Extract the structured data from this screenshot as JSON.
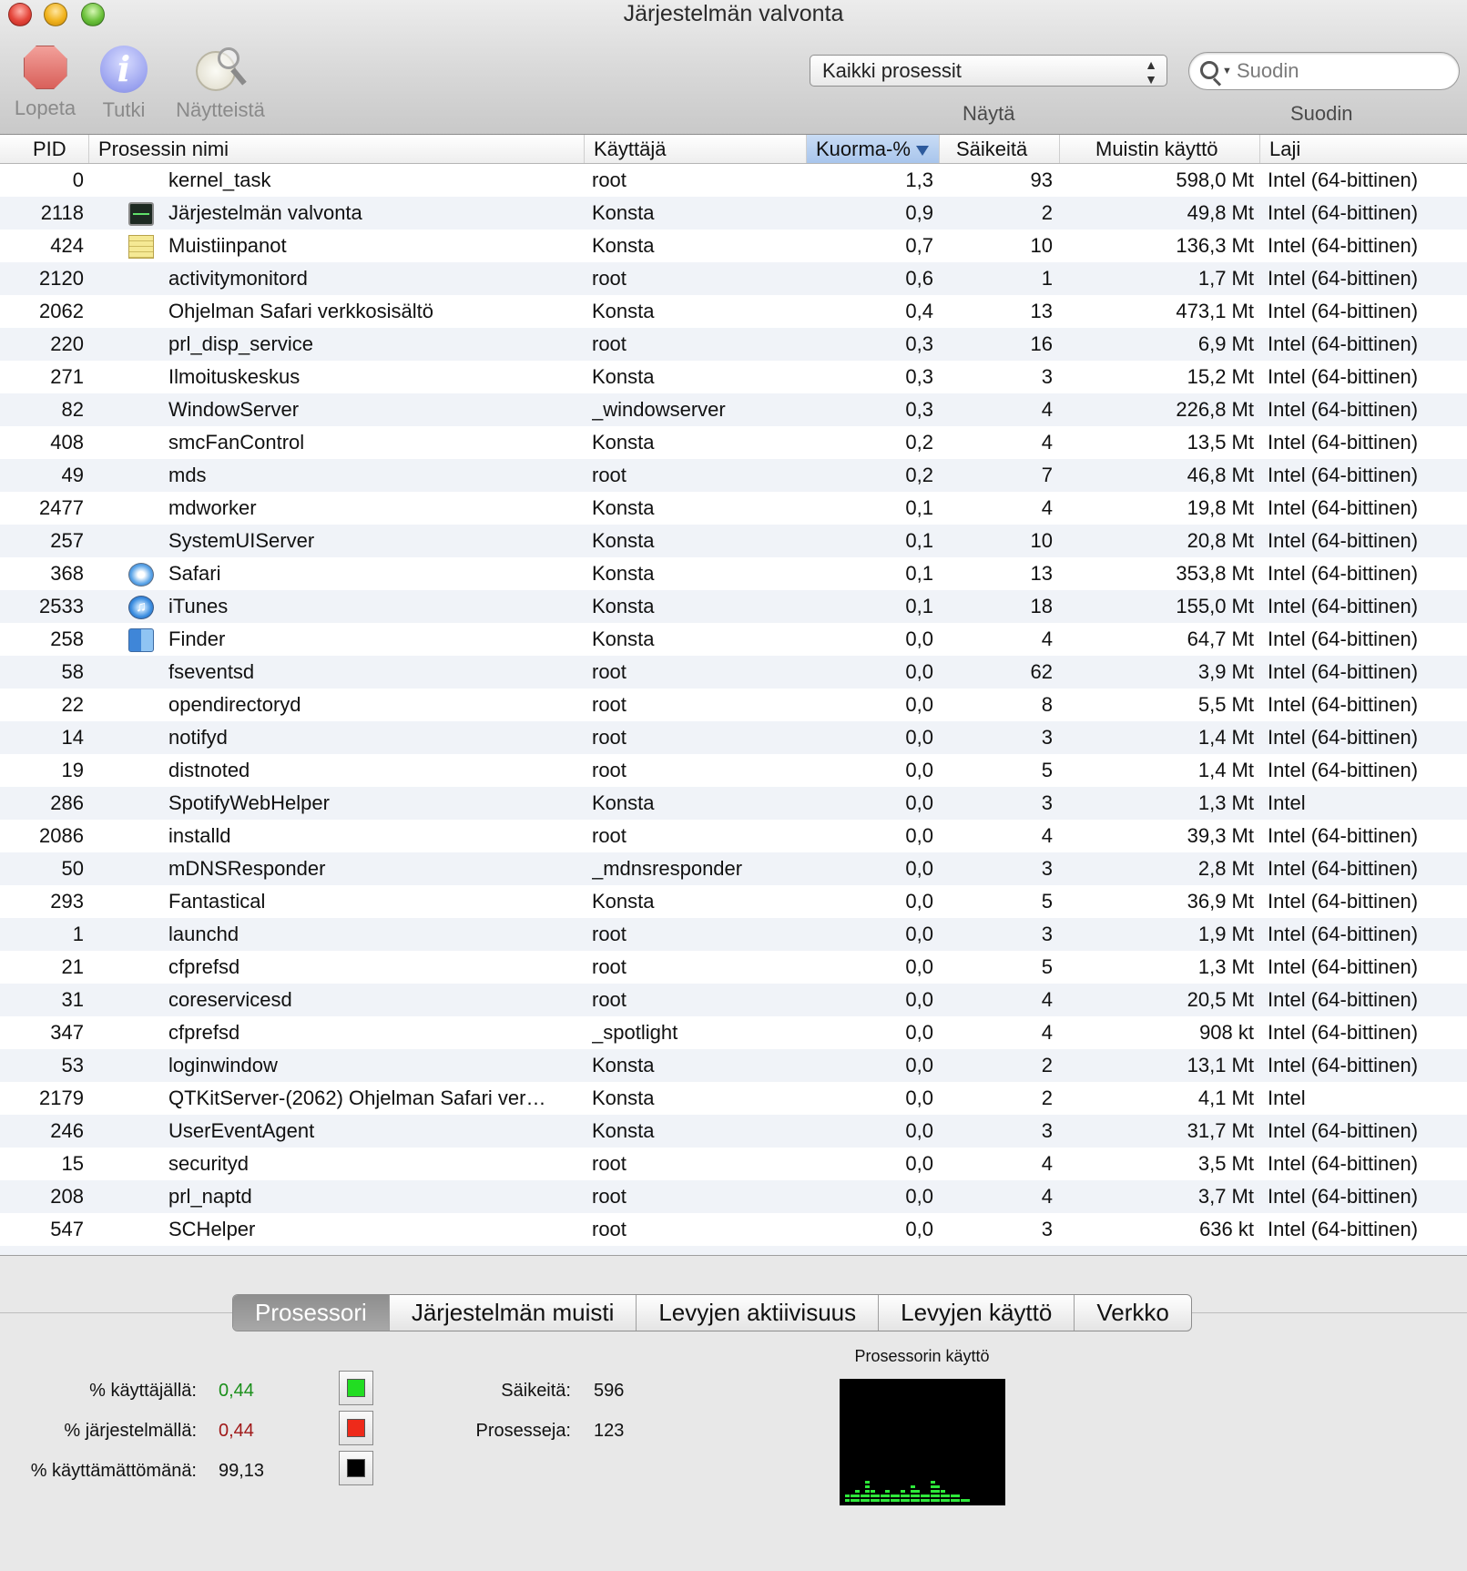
{
  "window": {
    "title": "Järjestelmän valvonta"
  },
  "toolbar": {
    "quit_label": "Lopeta",
    "inspect_label": "Tutki",
    "sample_label": "Näytteistä",
    "show_popup_value": "Kaikki prosessit",
    "show_caption": "Näytä",
    "filter_placeholder": "Suodin",
    "filter_caption": "Suodin"
  },
  "table": {
    "columns": {
      "pid": "PID",
      "name": "Prosessin nimi",
      "user": "Käyttäjä",
      "cpu": "Kuorma-%",
      "threads": "Säikeitä",
      "memory": "Muistin käyttö",
      "kind": "Laji"
    },
    "sorted_column": "cpu",
    "rows": [
      {
        "pid": "0",
        "icon": "",
        "name": "kernel_task",
        "user": "root",
        "cpu": "1,3",
        "threads": "93",
        "memory": "598,0 Mt",
        "kind": "Intel (64-bittinen)"
      },
      {
        "pid": "2118",
        "icon": "activity-monitor-icon",
        "name": "Järjestelmän valvonta",
        "user": "Konsta",
        "cpu": "0,9",
        "threads": "2",
        "memory": "49,8 Mt",
        "kind": "Intel (64-bittinen)"
      },
      {
        "pid": "424",
        "icon": "notes-icon",
        "name": "Muistiinpanot",
        "user": "Konsta",
        "cpu": "0,7",
        "threads": "10",
        "memory": "136,3 Mt",
        "kind": "Intel (64-bittinen)"
      },
      {
        "pid": "2120",
        "icon": "",
        "name": "activitymonitord",
        "user": "root",
        "cpu": "0,6",
        "threads": "1",
        "memory": "1,7 Mt",
        "kind": "Intel (64-bittinen)"
      },
      {
        "pid": "2062",
        "icon": "",
        "name": "Ohjelman Safari verkkosisältö",
        "user": "Konsta",
        "cpu": "0,4",
        "threads": "13",
        "memory": "473,1 Mt",
        "kind": "Intel (64-bittinen)"
      },
      {
        "pid": "220",
        "icon": "",
        "name": "prl_disp_service",
        "user": "root",
        "cpu": "0,3",
        "threads": "16",
        "memory": "6,9 Mt",
        "kind": "Intel (64-bittinen)"
      },
      {
        "pid": "271",
        "icon": "",
        "name": "Ilmoituskeskus",
        "user": "Konsta",
        "cpu": "0,3",
        "threads": "3",
        "memory": "15,2 Mt",
        "kind": "Intel (64-bittinen)"
      },
      {
        "pid": "82",
        "icon": "",
        "name": "WindowServer",
        "user": "_windowserver",
        "cpu": "0,3",
        "threads": "4",
        "memory": "226,8 Mt",
        "kind": "Intel (64-bittinen)"
      },
      {
        "pid": "408",
        "icon": "",
        "name": "smcFanControl",
        "user": "Konsta",
        "cpu": "0,2",
        "threads": "4",
        "memory": "13,5 Mt",
        "kind": "Intel (64-bittinen)"
      },
      {
        "pid": "49",
        "icon": "",
        "name": "mds",
        "user": "root",
        "cpu": "0,2",
        "threads": "7",
        "memory": "46,8 Mt",
        "kind": "Intel (64-bittinen)"
      },
      {
        "pid": "2477",
        "icon": "",
        "name": "mdworker",
        "user": "Konsta",
        "cpu": "0,1",
        "threads": "4",
        "memory": "19,8 Mt",
        "kind": "Intel (64-bittinen)"
      },
      {
        "pid": "257",
        "icon": "",
        "name": "SystemUIServer",
        "user": "Konsta",
        "cpu": "0,1",
        "threads": "10",
        "memory": "20,8 Mt",
        "kind": "Intel (64-bittinen)"
      },
      {
        "pid": "368",
        "icon": "safari-icon",
        "name": "Safari",
        "user": "Konsta",
        "cpu": "0,1",
        "threads": "13",
        "memory": "353,8 Mt",
        "kind": "Intel (64-bittinen)"
      },
      {
        "pid": "2533",
        "icon": "itunes-icon",
        "name": "iTunes",
        "user": "Konsta",
        "cpu": "0,1",
        "threads": "18",
        "memory": "155,0 Mt",
        "kind": "Intel (64-bittinen)"
      },
      {
        "pid": "258",
        "icon": "finder-icon",
        "name": "Finder",
        "user": "Konsta",
        "cpu": "0,0",
        "threads": "4",
        "memory": "64,7 Mt",
        "kind": "Intel (64-bittinen)"
      },
      {
        "pid": "58",
        "icon": "",
        "name": "fseventsd",
        "user": "root",
        "cpu": "0,0",
        "threads": "62",
        "memory": "3,9 Mt",
        "kind": "Intel (64-bittinen)"
      },
      {
        "pid": "22",
        "icon": "",
        "name": "opendirectoryd",
        "user": "root",
        "cpu": "0,0",
        "threads": "8",
        "memory": "5,5 Mt",
        "kind": "Intel (64-bittinen)"
      },
      {
        "pid": "14",
        "icon": "",
        "name": "notifyd",
        "user": "root",
        "cpu": "0,0",
        "threads": "3",
        "memory": "1,4 Mt",
        "kind": "Intel (64-bittinen)"
      },
      {
        "pid": "19",
        "icon": "",
        "name": "distnoted",
        "user": "root",
        "cpu": "0,0",
        "threads": "5",
        "memory": "1,4 Mt",
        "kind": "Intel (64-bittinen)"
      },
      {
        "pid": "286",
        "icon": "",
        "name": "SpotifyWebHelper",
        "user": "Konsta",
        "cpu": "0,0",
        "threads": "3",
        "memory": "1,3 Mt",
        "kind": "Intel"
      },
      {
        "pid": "2086",
        "icon": "",
        "name": "installd",
        "user": "root",
        "cpu": "0,0",
        "threads": "4",
        "memory": "39,3 Mt",
        "kind": "Intel (64-bittinen)"
      },
      {
        "pid": "50",
        "icon": "",
        "name": "mDNSResponder",
        "user": "_mdnsresponder",
        "cpu": "0,0",
        "threads": "3",
        "memory": "2,8 Mt",
        "kind": "Intel (64-bittinen)"
      },
      {
        "pid": "293",
        "icon": "",
        "name": "Fantastical",
        "user": "Konsta",
        "cpu": "0,0",
        "threads": "5",
        "memory": "36,9 Mt",
        "kind": "Intel (64-bittinen)"
      },
      {
        "pid": "1",
        "icon": "",
        "name": "launchd",
        "user": "root",
        "cpu": "0,0",
        "threads": "3",
        "memory": "1,9 Mt",
        "kind": "Intel (64-bittinen)"
      },
      {
        "pid": "21",
        "icon": "",
        "name": "cfprefsd",
        "user": "root",
        "cpu": "0,0",
        "threads": "5",
        "memory": "1,3 Mt",
        "kind": "Intel (64-bittinen)"
      },
      {
        "pid": "31",
        "icon": "",
        "name": "coreservicesd",
        "user": "root",
        "cpu": "0,0",
        "threads": "4",
        "memory": "20,5 Mt",
        "kind": "Intel (64-bittinen)"
      },
      {
        "pid": "347",
        "icon": "",
        "name": "cfprefsd",
        "user": "_spotlight",
        "cpu": "0,0",
        "threads": "4",
        "memory": "908 kt",
        "kind": "Intel (64-bittinen)"
      },
      {
        "pid": "53",
        "icon": "",
        "name": "loginwindow",
        "user": "Konsta",
        "cpu": "0,0",
        "threads": "2",
        "memory": "13,1 Mt",
        "kind": "Intel (64-bittinen)"
      },
      {
        "pid": "2179",
        "icon": "",
        "name": "QTKitServer-(2062) Ohjelman Safari ver…",
        "user": "Konsta",
        "cpu": "0,0",
        "threads": "2",
        "memory": "4,1 Mt",
        "kind": "Intel"
      },
      {
        "pid": "246",
        "icon": "",
        "name": "UserEventAgent",
        "user": "Konsta",
        "cpu": "0,0",
        "threads": "3",
        "memory": "31,7 Mt",
        "kind": "Intel (64-bittinen)"
      },
      {
        "pid": "15",
        "icon": "",
        "name": "securityd",
        "user": "root",
        "cpu": "0,0",
        "threads": "4",
        "memory": "3,5 Mt",
        "kind": "Intel (64-bittinen)"
      },
      {
        "pid": "208",
        "icon": "",
        "name": "prl_naptd",
        "user": "root",
        "cpu": "0,0",
        "threads": "4",
        "memory": "3,7 Mt",
        "kind": "Intel (64-bittinen)"
      },
      {
        "pid": "547",
        "icon": "",
        "name": "SCHelper",
        "user": "root",
        "cpu": "0,0",
        "threads": "3",
        "memory": "636 kt",
        "kind": "Intel (64-bittinen)"
      }
    ]
  },
  "tabs": [
    {
      "label": "Prosessori",
      "active": true
    },
    {
      "label": "Järjestelmän muisti",
      "active": false
    },
    {
      "label": "Levyjen aktiivisuus",
      "active": false
    },
    {
      "label": "Levyjen käyttö",
      "active": false
    },
    {
      "label": "Verkko",
      "active": false
    }
  ],
  "cpu_panel": {
    "user_label": "% käyttäjällä:",
    "user_value": "0,44",
    "system_label": "% järjestelmällä:",
    "system_value": "0,44",
    "idle_label": "% käyttämättömänä:",
    "idle_value": "99,13",
    "threads_label": "Säikeitä:",
    "threads_value": "596",
    "processes_label": "Prosesseja:",
    "processes_value": "123",
    "graph_title": "Prosessorin käyttö",
    "colors": {
      "user": "#22dd22",
      "system": "#ee2a1a",
      "idle": "#000000",
      "user_text": "#1a8f1a",
      "system_text": "#a01818"
    },
    "history_levels": [
      2,
      2,
      3,
      2,
      5,
      3,
      2,
      2,
      3,
      2,
      2,
      3,
      2,
      4,
      3,
      2,
      2,
      5,
      4,
      3,
      2,
      2,
      2,
      1,
      1
    ]
  }
}
